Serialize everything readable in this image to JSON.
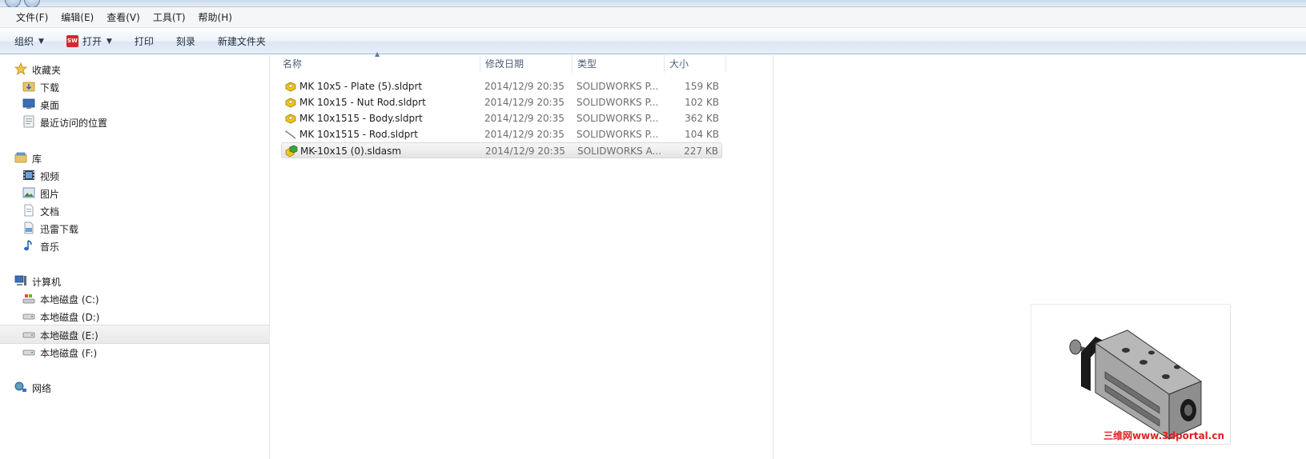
{
  "menu": {
    "items": [
      "文件(F)",
      "编辑(E)",
      "查看(V)",
      "工具(T)",
      "帮助(H)"
    ]
  },
  "toolbar": {
    "organize_label": "组织",
    "open_label": "打开",
    "print_label": "打印",
    "burn_label": "刻录",
    "new_folder_label": "新建文件夹"
  },
  "nav": {
    "favorites": {
      "label": "收藏夹",
      "items": [
        "下载",
        "桌面",
        "最近访问的位置"
      ]
    },
    "libraries": {
      "label": "库",
      "items": [
        "视频",
        "图片",
        "文档",
        "迅雷下载",
        "音乐"
      ]
    },
    "computer": {
      "label": "计算机",
      "items": [
        "本地磁盘 (C:)",
        "本地磁盘 (D:)",
        "本地磁盘 (E:)",
        "本地磁盘 (F:)"
      ],
      "selected": "本地磁盘 (E:)"
    },
    "network": {
      "label": "网络"
    }
  },
  "file_list": {
    "columns": [
      "名称",
      "修改日期",
      "类型",
      "大小"
    ],
    "rows": [
      {
        "name": "MK 10x5 - Plate (5).sldprt",
        "date": "2014/12/9 20:35",
        "type": "SOLIDWORKS P...",
        "size": "159 KB",
        "icon": "sldprt-icon"
      },
      {
        "name": "MK 10x15 - Nut Rod.sldprt",
        "date": "2014/12/9 20:35",
        "type": "SOLIDWORKS P...",
        "size": "102 KB",
        "icon": "sldprt-icon"
      },
      {
        "name": "MK 10x1515 - Body.sldprt",
        "date": "2014/12/9 20:35",
        "type": "SOLIDWORKS P...",
        "size": "362 KB",
        "icon": "sldprt-icon"
      },
      {
        "name": "MK 10x1515 - Rod.sldprt",
        "date": "2014/12/9 20:35",
        "type": "SOLIDWORKS P...",
        "size": "104 KB",
        "icon": "rod-part-icon"
      },
      {
        "name": "MK-10x15 (0).sldasm",
        "date": "2014/12/9 20:35",
        "type": "SOLIDWORKS A...",
        "size": "227 KB",
        "icon": "sldasm-icon"
      }
    ],
    "selected_row": 4
  },
  "preview": {
    "watermark": "三维网www.3dportal.cn"
  },
  "colors": {
    "accent": "#3b7dd8",
    "solidworks_red": "#d8262b",
    "part_yellow": "#f0c419",
    "assembly_green": "#3aa63a",
    "watermark_red": "#e02020"
  }
}
